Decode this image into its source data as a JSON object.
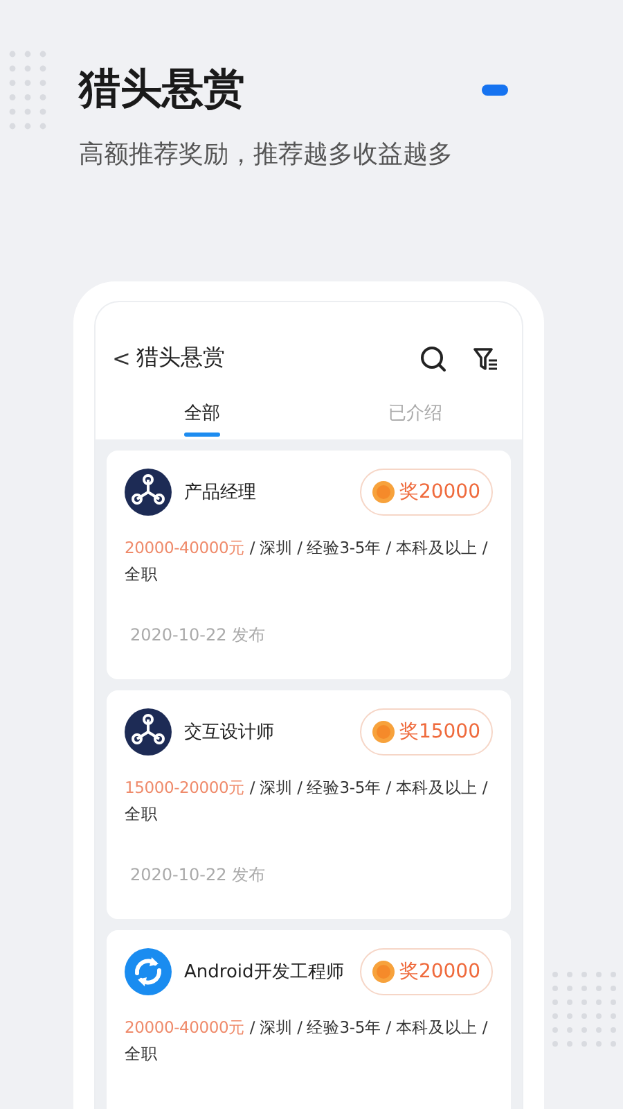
{
  "hero": {
    "title": "猎头悬赏",
    "subtitle": "高额推荐奖励，推荐越多收益越多"
  },
  "app_bar": {
    "back": "<",
    "title": "猎头悬赏"
  },
  "tabs": [
    {
      "label": "全部",
      "selected": true
    },
    {
      "label": "已介绍",
      "selected": false
    }
  ],
  "jobs": [
    {
      "kind": "hub",
      "title": "产品经理",
      "reward": "奖20000",
      "salary": "20000-40000元",
      "details": " / 深圳 / 经验3-5年 / 本科及以上 / 全职",
      "date": "2020-10-22 发布"
    },
    {
      "kind": "hub",
      "title": "交互设计师",
      "reward": "奖15000",
      "salary": "15000-20000元",
      "details": " / 深圳 / 经验3-5年 / 本科及以上 / 全职",
      "date": "2020-10-22 发布"
    },
    {
      "kind": "sync",
      "title": "Android开发工程师",
      "reward": "奖20000",
      "salary": "20000-40000元",
      "details": " / 深圳 / 经验3-5年 / 本科及以上 / 全职"
    }
  ]
}
